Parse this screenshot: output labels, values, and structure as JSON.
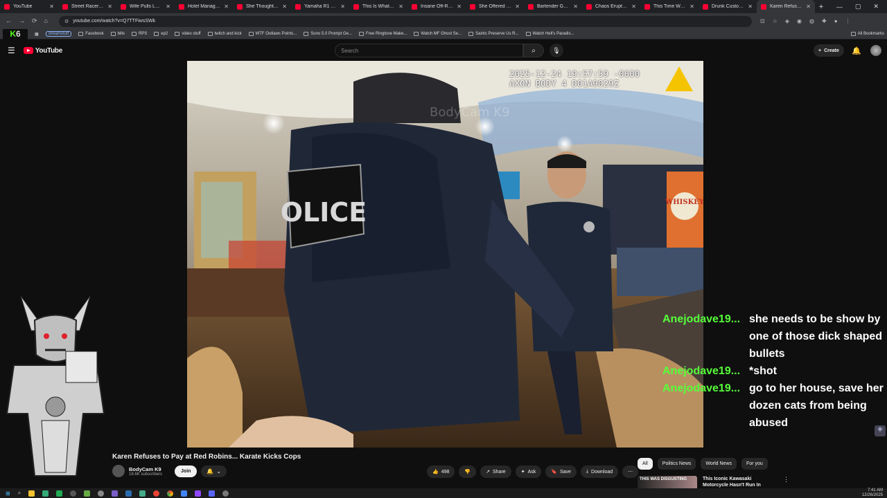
{
  "browser": {
    "tabs": [
      {
        "title": "YouTube"
      },
      {
        "title": "Street Racer Real..."
      },
      {
        "title": "Wife Pulls Loaded..."
      },
      {
        "title": "Hotel Manager Ca..."
      },
      {
        "title": "She Thought She..."
      },
      {
        "title": "Yamaha R1 Takes..."
      },
      {
        "title": "This Is What Happ..."
      },
      {
        "title": "Insane Off-Road ..."
      },
      {
        "title": "She Offered Mon..."
      },
      {
        "title": "Bartender Gets 2..."
      },
      {
        "title": "Chaos Erupts Wh..."
      },
      {
        "title": "This Time Wasn't..."
      },
      {
        "title": "Drunk Customer..."
      },
      {
        "title": "Karen Refuses..."
      }
    ],
    "url": "youtube.com/watch?v=Q7TTFiwsSWk",
    "bookmarks": [
      {
        "label": "streamstuff",
        "type": "pill"
      },
      {
        "label": "Facebook"
      },
      {
        "label": "bills"
      },
      {
        "label": "RPS"
      },
      {
        "label": "ep2"
      },
      {
        "label": "video stuff"
      },
      {
        "label": "twitch and kick"
      },
      {
        "label": "WTF Outlaws Points..."
      },
      {
        "label": "Suno 5.0 Prompt Ge..."
      },
      {
        "label": "Free Ringtone Make..."
      },
      {
        "label": "Watch MF Ghost Se..."
      },
      {
        "label": "Saints Preserve Us R..."
      },
      {
        "label": "Watch Hell's Paradis..."
      }
    ],
    "all_bookmarks": "All Bookmarks",
    "kick_badge": {
      "k": "K",
      "num": "6"
    }
  },
  "youtube": {
    "logo_text": "YouTube",
    "search_placeholder": "Search",
    "create_label": "Create"
  },
  "video": {
    "timestamp_line1": "2025-12-24 19:57:59 -0600",
    "timestamp_line2": "AXON BODY 4 D01A9029Z",
    "watermark": "BodyCam K9",
    "vest_text": "OLICE",
    "sign_text": "WHISKEY",
    "title": "Karen Refuses to Pay at Red Robins... Karate Kicks Cops",
    "channel_name": "BodyCam K9",
    "subscribers": "18.6K subscribers",
    "join_label": "Join",
    "likes": "498",
    "share_label": "Share",
    "ask_label": "Ask",
    "save_label": "Save",
    "download_label": "Download"
  },
  "chat": [
    {
      "user": "Anejodave19...",
      "msg": "she needs to be show by one of those dick shaped bullets"
    },
    {
      "user": "Anejodave19...",
      "msg": "*shot"
    },
    {
      "user": "Anejodave19...",
      "msg": "go to her house, save her dozen cats from being abused"
    }
  ],
  "sidebar": {
    "chips": [
      "All",
      "Politics News",
      "World News",
      "For you"
    ],
    "rec_thumb_text": "THIS WAS DISGUSTING",
    "rec_title": "This Iconic Kawasaki Motorcycle Hasn't Run In Over..."
  },
  "taskbar": {
    "time": "7:41 AM",
    "date": "12/26/2025"
  }
}
